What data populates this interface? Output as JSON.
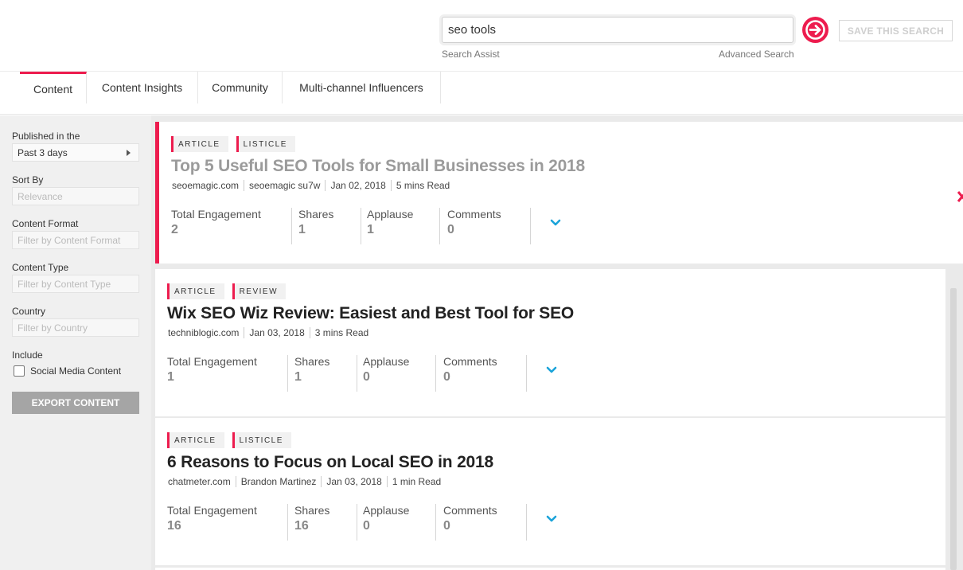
{
  "search": {
    "query": "seo tools",
    "assist_label": "Search Assist",
    "advanced_label": "Advanced Search",
    "save_label": "SAVE THIS SEARCH"
  },
  "tabs": [
    {
      "label": "Content"
    },
    {
      "label": "Content Insights"
    },
    {
      "label": "Community"
    },
    {
      "label": "Multi-channel Influencers"
    }
  ],
  "filters": {
    "published_label": "Published in the",
    "published_value": "Past 3 days",
    "sort_label": "Sort By",
    "sort_placeholder": "Relevance",
    "format_label": "Content Format",
    "format_placeholder": "Filter by Content Format",
    "type_label": "Content Type",
    "type_placeholder": "Filter by Content Type",
    "country_label": "Country",
    "country_placeholder": "Filter by Country",
    "include_label": "Include",
    "social_label": "Social Media Content",
    "export_label": "EXPORT CONTENT"
  },
  "stat_labels": {
    "engagement": "Total Engagement",
    "shares": "Shares",
    "applause": "Applause",
    "comments": "Comments"
  },
  "results": [
    {
      "tags": [
        "ARTICLE",
        "LISTICLE"
      ],
      "title": "Top 5 Useful SEO Tools for Small Businesses in 2018",
      "meta": [
        "seoemagic.com",
        "seoemagic su7w",
        "Jan 02, 2018",
        "5 mins Read"
      ],
      "engagement": "2",
      "shares": "1",
      "applause": "1",
      "comments": "0"
    },
    {
      "tags": [
        "ARTICLE",
        "REVIEW"
      ],
      "title": "Wix SEO Wiz Review: Easiest and Best Tool for SEO",
      "meta": [
        "techniblogic.com",
        "Jan 03, 2018",
        "3 mins Read"
      ],
      "engagement": "1",
      "shares": "1",
      "applause": "0",
      "comments": "0"
    },
    {
      "tags": [
        "ARTICLE",
        "LISTICLE"
      ],
      "title": "6 Reasons to Focus on Local SEO in 2018",
      "meta": [
        "chatmeter.com",
        "Brandon Martinez",
        "Jan 03, 2018",
        "1 min Read"
      ],
      "engagement": "16",
      "shares": "16",
      "applause": "0",
      "comments": "0"
    }
  ],
  "colors": {
    "accent": "#ed1c4e",
    "chevron": "#1aa3d9"
  }
}
